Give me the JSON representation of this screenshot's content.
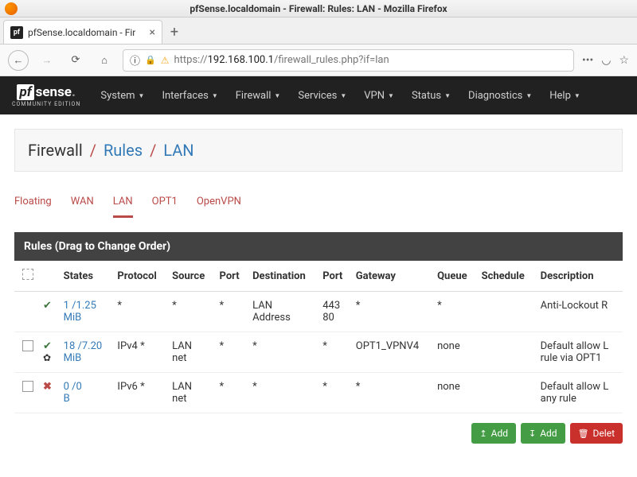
{
  "os": {
    "title": "pfSense.localdomain - Firewall: Rules: LAN - Mozilla Firefox"
  },
  "tab": {
    "label": "pfSense.localdomain - Fir"
  },
  "url": {
    "prefix": "https://",
    "host": "192.168.100.1",
    "path": "/firewall_rules.php?if=lan"
  },
  "logo": {
    "pf": "pf",
    "sense": "sense",
    "edition": "COMMUNITY EDITION"
  },
  "nav": {
    "system": "System",
    "interfaces": "Interfaces",
    "firewall": "Firewall",
    "services": "Services",
    "vpn": "VPN",
    "status": "Status",
    "diagnostics": "Diagnostics",
    "help": "Help"
  },
  "bc": {
    "l0": "Firewall",
    "l1": "Rules",
    "l2": "LAN"
  },
  "subtabs": {
    "floating": "Floating",
    "wan": "WAN",
    "lan": "LAN",
    "opt1": "OPT1",
    "openvpn": "OpenVPN"
  },
  "panel": {
    "title": "Rules (Drag to Change Order)"
  },
  "cols": {
    "states": "States",
    "protocol": "Protocol",
    "source": "Source",
    "sport": "Port",
    "destination": "Destination",
    "dport": "Port",
    "gateway": "Gateway",
    "queue": "Queue",
    "schedule": "Schedule",
    "description": "Description"
  },
  "rows": [
    {
      "checkable": false,
      "status": "ok",
      "gear": false,
      "states": "1 /1.25 MiB",
      "protocol": "*",
      "source": "*",
      "sport": "*",
      "destination": "LAN Address",
      "dport": "443 80",
      "gateway": "*",
      "queue": "*",
      "schedule": "",
      "description": "Anti-Lockout R"
    },
    {
      "checkable": true,
      "status": "ok",
      "gear": true,
      "states": "18 /7.20 MiB",
      "protocol": "IPv4 *",
      "source": "LAN net",
      "sport": "*",
      "destination": "*",
      "dport": "*",
      "gateway": "OPT1_VPNV4",
      "queue": "none",
      "schedule": "",
      "description": "Default allow L rule via OPT1"
    },
    {
      "checkable": true,
      "status": "bad",
      "gear": false,
      "states": "0 /0 B",
      "protocol": "IPv6 *",
      "source": "LAN net",
      "sport": "*",
      "destination": "*",
      "dport": "*",
      "gateway": "*",
      "queue": "none",
      "schedule": "",
      "description": "Default allow L any rule"
    }
  ],
  "buttons": {
    "add_up": "Add",
    "add_down": "Add",
    "delete": "Delet"
  }
}
